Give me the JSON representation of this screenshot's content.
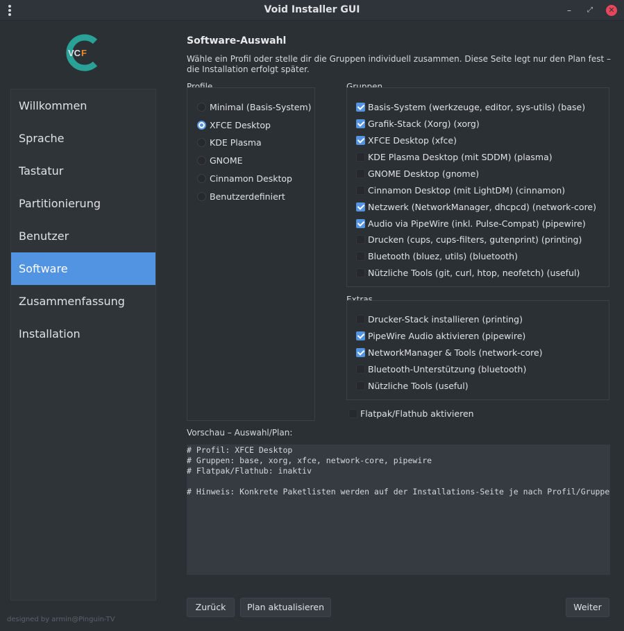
{
  "window": {
    "title": "Void Installer GUI"
  },
  "logo": {
    "left_text": "VC",
    "right_text": "F",
    "accent": "#e98c2c",
    "ring_color": "#2aa197"
  },
  "sidebar": {
    "items": [
      {
        "label": "Willkommen"
      },
      {
        "label": "Sprache"
      },
      {
        "label": "Tastatur"
      },
      {
        "label": "Partitionierung"
      },
      {
        "label": "Benutzer"
      },
      {
        "label": "Software",
        "active": true
      },
      {
        "label": "Zusammenfassung"
      },
      {
        "label": "Installation"
      }
    ],
    "credit": "designed by armin@Pinguin-TV"
  },
  "page": {
    "title": "Software-Auswahl",
    "description": "Wähle ein Profil oder stelle dir die Gruppen individuell zusammen. Diese Seite legt nur den Plan fest – die Installation erfolgt später."
  },
  "profiles": {
    "label": "Profile",
    "options": [
      {
        "label": "Minimal (Basis-System)",
        "selected": false
      },
      {
        "label": "XFCE Desktop",
        "selected": true
      },
      {
        "label": "KDE Plasma",
        "selected": false
      },
      {
        "label": "GNOME",
        "selected": false
      },
      {
        "label": "Cinnamon Desktop",
        "selected": false
      },
      {
        "label": "Benutzerdefiniert",
        "selected": false
      }
    ]
  },
  "groups": {
    "label": "Gruppen",
    "items": [
      {
        "label": "Basis-System (werkzeuge, editor, sys-utils)  (base)",
        "checked": true
      },
      {
        "label": "Grafik-Stack (Xorg)  (xorg)",
        "checked": true
      },
      {
        "label": "XFCE Desktop  (xfce)",
        "checked": true
      },
      {
        "label": "KDE Plasma Desktop (mit SDDM)  (plasma)",
        "checked": false
      },
      {
        "label": "GNOME Desktop  (gnome)",
        "checked": false
      },
      {
        "label": "Cinnamon Desktop (mit LightDM)  (cinnamon)",
        "checked": false
      },
      {
        "label": "Netzwerk (NetworkManager, dhcpcd)  (network-core)",
        "checked": true
      },
      {
        "label": "Audio via PipeWire (inkl. Pulse-Compat)  (pipewire)",
        "checked": true
      },
      {
        "label": "Drucken (cups, cups-filters, gutenprint)  (printing)",
        "checked": false
      },
      {
        "label": "Bluetooth (bluez, utils)  (bluetooth)",
        "checked": false
      },
      {
        "label": "Nützliche Tools (git, curl, htop, neofetch)  (useful)",
        "checked": false
      }
    ]
  },
  "extras": {
    "label": "Extras",
    "items": [
      {
        "label": "Drucker-Stack installieren   (printing)",
        "checked": false
      },
      {
        "label": "PipeWire Audio aktivieren   (pipewire)",
        "checked": true
      },
      {
        "label": "NetworkManager & Tools   (network-core)",
        "checked": true
      },
      {
        "label": "Bluetooth-Unterstützung   (bluetooth)",
        "checked": false
      },
      {
        "label": "Nützliche Tools   (useful)",
        "checked": false
      }
    ]
  },
  "flatpak": {
    "label": "Flatpak/Flathub aktivieren",
    "checked": false
  },
  "preview": {
    "label": "Vorschau – Auswahl/Plan:",
    "lines": [
      "# Profil: XFCE Desktop",
      "# Gruppen: base, xorg, xfce, network-core, pipewire",
      "# Flatpak/Flathub: inaktiv",
      "",
      "# Hinweis: Konkrete Paketlisten werden auf der Installations-Seite je nach Profil/Gruppen"
    ]
  },
  "buttons": {
    "back": "Zurück",
    "update_plan": "Plan aktualisieren",
    "next": "Weiter"
  },
  "colors": {
    "accent": "#5294e2",
    "background": "#2b3035",
    "close": "#e8465b"
  }
}
